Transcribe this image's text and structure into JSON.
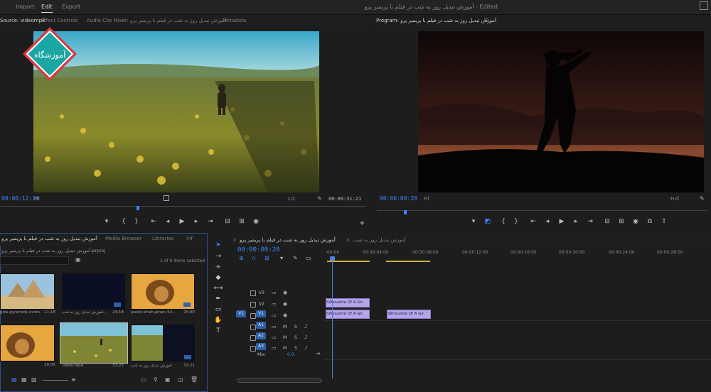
{
  "menu": {
    "import": "Import",
    "edit": "Edit",
    "export": "Export"
  },
  "window_title": "آموزش تبدیل روز به شب در فیلم با پریمیر پرو - Edited",
  "source_tabs": [
    "Source: videomp4",
    "Effect Controls",
    "Audio Clip Mixer: آموزش تبدیل روز به شب در فیلم با پریمیر پرو",
    "Metadata"
  ],
  "program_tab": "Program: آموزش تبدیل روز به شب در فیلم با پریمیر پرو",
  "source": {
    "timecode": "00:00:12:19",
    "fit": "Fit",
    "zoom": "1/2",
    "duration": "00:00:31:21"
  },
  "program": {
    "timecode": "00:00:00:20",
    "fit": "Fit",
    "quality": "Full"
  },
  "project": {
    "tabs": [
      "آموزش تبدیل روز به شب در فیلم با پریمیر پرو",
      "Media Browser",
      "Libraries",
      "Inf"
    ],
    "path": "آموزش تبدیل روز به شب در فیلم با پریمیر پرو.prproj",
    "selection": "1 of 9 items selected",
    "items": [
      {
        "label": "giza-pyramids-ovdrs...",
        "duration": "11:18"
      },
      {
        "label": "آموزش تبدیل روز به شب...",
        "duration": "24:18"
      },
      {
        "label": "jaswiz-shah-jahan-54...",
        "duration": "20:00"
      },
      {
        "label": "",
        "duration": "20:05"
      },
      {
        "label": "video.mp4",
        "duration": "31:21"
      },
      {
        "label": "آموزش تبدیل روز به شب",
        "duration": "31:21"
      }
    ]
  },
  "timeline": {
    "tabs": [
      "آموزش تبدیل روز به شب در فیلم با پریمیر پرو",
      "آموزش تبدیل روز به شب"
    ],
    "timecode": "00:00:00:20",
    "ruler": [
      ":00:00",
      "00:00:04:00",
      "00:00:08:00",
      "00:00:12:00",
      "00:00:16:00",
      "00:00:20:00",
      "00:00:24:00",
      "00:00:28:00"
    ],
    "video_tracks": [
      "V3",
      "V2",
      "V1"
    ],
    "audio_tracks": [
      "A1",
      "A2",
      "A3"
    ],
    "master": {
      "label": "Mix",
      "value": "0.0"
    },
    "clips": [
      {
        "text": "Silhouette Of A Gir",
        "track": "V2"
      },
      {
        "text": "Silhouette Of A Gir",
        "track": "V1"
      },
      {
        "text": "Silhouette Of A Gir",
        "track": "V1-b"
      }
    ],
    "track_letters": {
      "m": "M",
      "s": "S",
      "v1_source": "V1"
    }
  },
  "logo": {
    "text": "آموزشگاه"
  },
  "colors": {
    "accent_blue": "#3b86ff",
    "clip_purple": "#b4a6e6",
    "playhead": "#4d7fe0",
    "logo_teal": "#1aa6a3",
    "logo_red": "#d93a3f"
  }
}
